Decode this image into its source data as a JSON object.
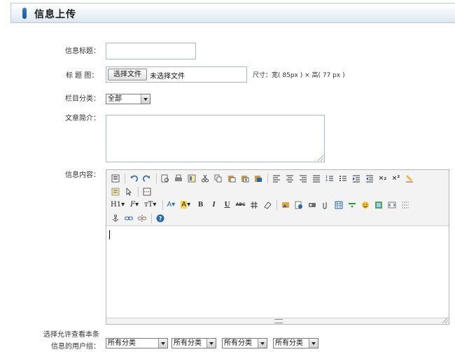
{
  "header": {
    "title": "信息上传"
  },
  "form": {
    "title_label": "信息标题：",
    "title_value": "",
    "image_label": "标 题 图：",
    "file_button": "选择文件",
    "file_status": "未选择文件",
    "size_hint": "尺寸：宽( 85px ) × 高( 77 px )",
    "category_label": "栏目分类：",
    "category_value": "全部",
    "summary_label": "文章简介：",
    "summary_value": "",
    "content_label": "信息内容：",
    "usergroup_label_line1": "选择允许查看本条",
    "usergroup_label_line2": "信息的用户组：",
    "usergroup_selects": [
      "所有分类",
      "所有分类",
      "所有分类",
      "所有分类"
    ]
  },
  "editor": {
    "toolbar_text": {
      "heading": "H1",
      "font": "F",
      "size": "тT",
      "bold": "B",
      "italic": "I",
      "underline": "U",
      "strike": "ABC",
      "subscript": "×₂",
      "superscript": "×²"
    }
  },
  "colors": {
    "accent": "#2a67a8",
    "header_border": "#b7c8da"
  }
}
